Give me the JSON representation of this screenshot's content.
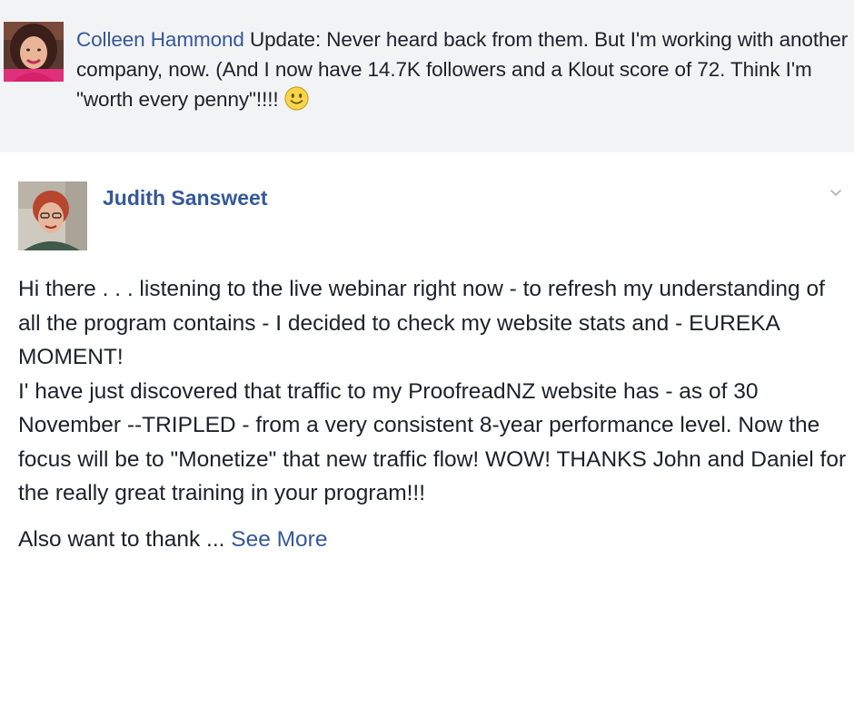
{
  "reply": {
    "author": "Colleen Hammond",
    "text": " Update: Never heard back from them. But I'm working with another company, now. (And I now have 14.7K followers and a Klout score of 72. Think I'm \"worth every penny\"!!!!",
    "emoji": "smiley-face-icon"
  },
  "post": {
    "author": "Judith Sansweet",
    "menu_icon": "chevron-down-icon",
    "paragraphs": [
      "Hi there . . . listening to the live webinar right now - to refresh my understanding of all the program contains - I decided to check my website stats and - EUREKA MOMENT!",
      "I' have just discovered that traffic to my ProofreadNZ website has - as of 30 November --TRIPLED - from a very consistent 8-year performance level. Now the focus will be to \"Monetize\" that new traffic flow! WOW! THANKS John and Daniel for the really great training in your program!!!"
    ],
    "truncated_text": "Also want to thank ... ",
    "see_more_label": "See More"
  },
  "colors": {
    "link": "#365899",
    "text": "#1d2129",
    "reply_background": "#f2f3f5"
  }
}
